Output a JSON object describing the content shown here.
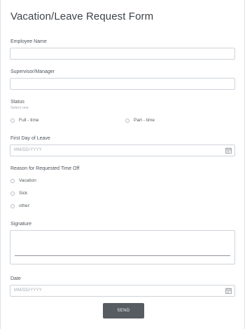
{
  "form": {
    "title": "Vacation/Leave Request Form",
    "employee_name": {
      "label": "Employee Name",
      "value": ""
    },
    "supervisor": {
      "label": "Supervisor/Manager",
      "value": ""
    },
    "status": {
      "label": "Status",
      "sublabel": "Select one",
      "options": [
        "Full - time",
        "Part - time"
      ]
    },
    "first_day": {
      "label": "First Day of Leave",
      "placeholder": "MM/DD/YYYY"
    },
    "reason": {
      "label": "Reason for Requested Time Off",
      "options": [
        "Vacation",
        "Sick",
        "other:"
      ]
    },
    "signature": {
      "label": "Signature"
    },
    "date": {
      "label": "Date",
      "placeholder": "MM/DD/YYYY"
    },
    "send_label": "SEND"
  },
  "icons": {
    "calendar": "calendar-icon"
  },
  "colors": {
    "button_bg": "#575c62",
    "border": "#cfd4d9",
    "text": "#4e545b"
  }
}
